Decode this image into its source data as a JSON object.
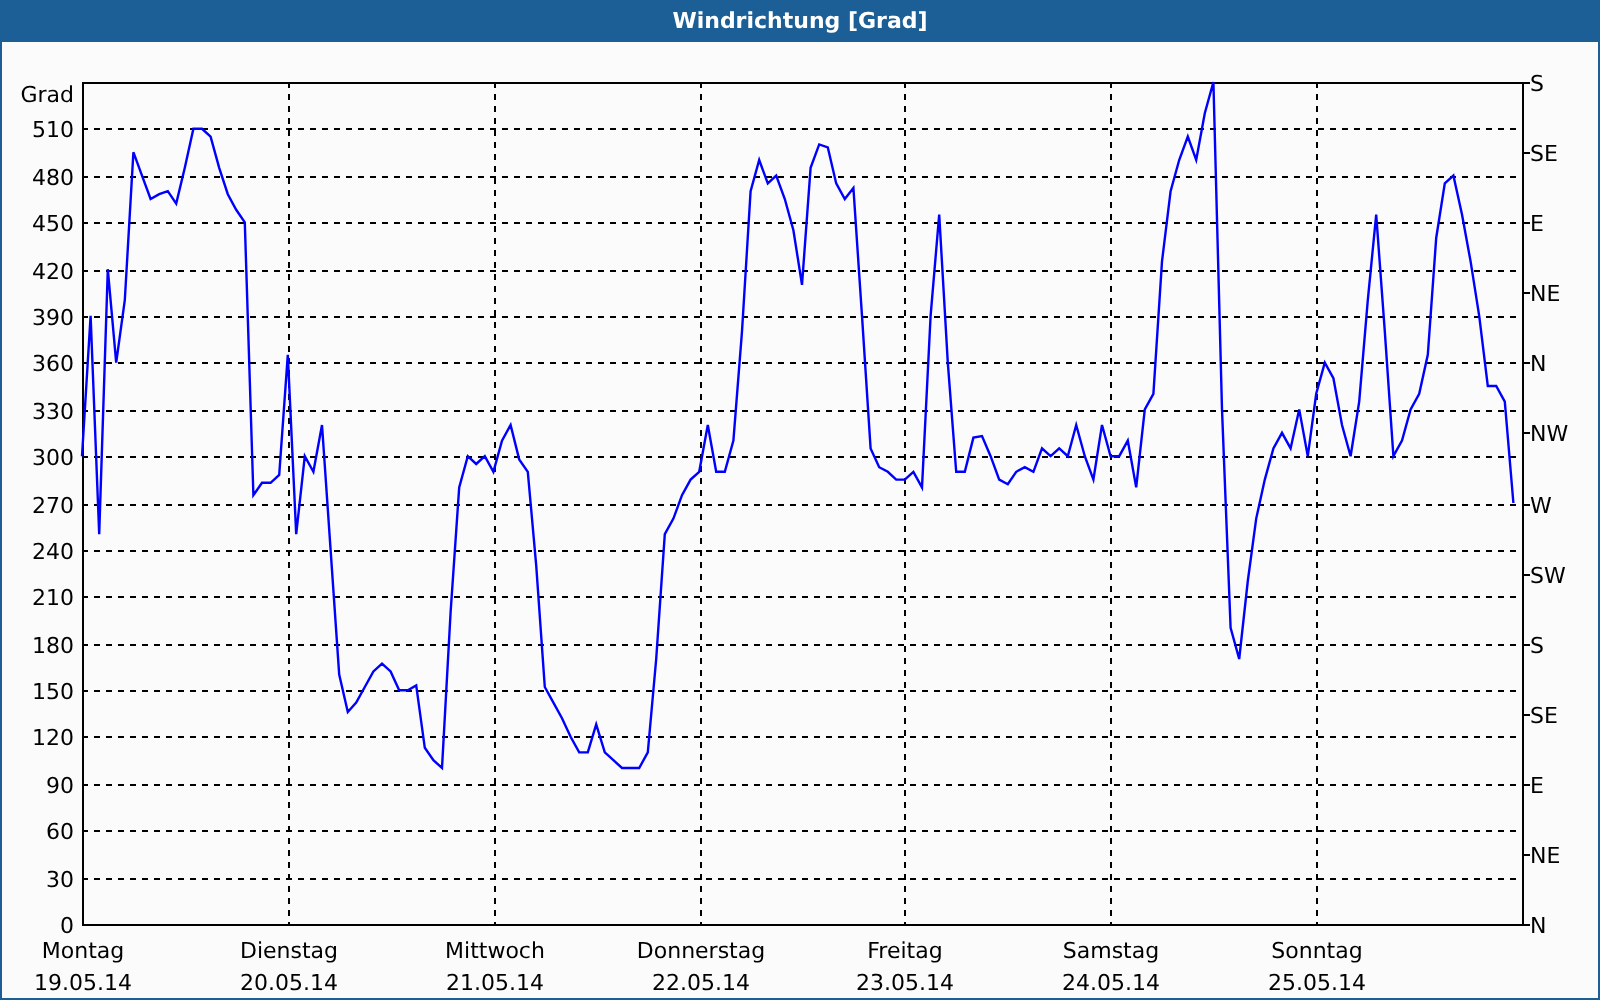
{
  "window": {
    "title": "Windrichtung [Grad]"
  },
  "chart": {
    "chart_data": {
      "type": "line",
      "grid": true,
      "ylabel": "Grad",
      "ylim": [
        0,
        540
      ],
      "yticks": [
        0,
        30,
        60,
        90,
        120,
        150,
        180,
        210,
        240,
        270,
        300,
        330,
        360,
        390,
        420,
        450,
        480,
        510
      ],
      "categories": [
        "Montag",
        null,
        null,
        null,
        null,
        null,
        null,
        null,
        null,
        null,
        null,
        null,
        null,
        null,
        null,
        null,
        null,
        null,
        null,
        null,
        null,
        null,
        null,
        null,
        "Dienstag",
        null,
        null,
        null,
        null,
        null,
        null,
        null,
        null,
        null,
        null,
        null,
        null,
        null,
        null,
        null,
        null,
        null,
        null,
        null,
        null,
        null,
        null,
        null,
        "Mittwoch",
        null,
        null,
        null,
        null,
        null,
        null,
        null,
        null,
        null,
        null,
        null,
        null,
        null,
        null,
        null,
        null,
        null,
        null,
        null,
        null,
        null,
        null,
        null,
        "Donnerstag",
        null,
        null,
        null,
        null,
        null,
        null,
        null,
        null,
        null,
        null,
        null,
        null,
        null,
        null,
        null,
        null,
        null,
        null,
        null,
        null,
        null,
        null,
        null,
        "Freitag",
        null,
        null,
        null,
        null,
        null,
        null,
        null,
        null,
        null,
        null,
        null,
        null,
        null,
        null,
        null,
        null,
        null,
        null,
        null,
        null,
        null,
        null,
        null,
        "Samstag",
        null,
        null,
        null,
        null,
        null,
        null,
        null,
        null,
        null,
        null,
        null,
        null,
        null,
        null,
        null,
        null,
        null,
        null,
        null,
        null,
        null,
        null,
        null,
        "Sonntag",
        null,
        null,
        null,
        null,
        null,
        null,
        null,
        null,
        null,
        null,
        null,
        null,
        null,
        null,
        null,
        null,
        null,
        null,
        null,
        null,
        null,
        null,
        null
      ],
      "series": [
        {
          "color": "#0000ff",
          "values": [
            300,
            390,
            250,
            420,
            360,
            400,
            495,
            480,
            465,
            468,
            470,
            462,
            485,
            510,
            510,
            505,
            485,
            468,
            458,
            450,
            275,
            283,
            283,
            288,
            365,
            250,
            300,
            290,
            320,
            240,
            160,
            136,
            142,
            152,
            162,
            167,
            162,
            150,
            150,
            153,
            113,
            105,
            100,
            200,
            280,
            300,
            295,
            300,
            290,
            310,
            320,
            298,
            290,
            230,
            152,
            142,
            132,
            120,
            110,
            110,
            128,
            110,
            105,
            100,
            100,
            100,
            110,
            170,
            250,
            260,
            275,
            285,
            290,
            320,
            290,
            290,
            310,
            380,
            470,
            490,
            475,
            480,
            465,
            445,
            410,
            485,
            500,
            498,
            475,
            465,
            472,
            390,
            305,
            293,
            290,
            285,
            285,
            290,
            280,
            390,
            455,
            360,
            290,
            290,
            312,
            313,
            300,
            285,
            282,
            290,
            293,
            290,
            305,
            300,
            305,
            300,
            320,
            300,
            285,
            320,
            300,
            300,
            310,
            280,
            330,
            340,
            425,
            470,
            490,
            505,
            490,
            520,
            540,
            330,
            190,
            170,
            220,
            260,
            285,
            305,
            315,
            305,
            330,
            300,
            340,
            360,
            350,
            320,
            300,
            335,
            400,
            455,
            380,
            300,
            310,
            330,
            340,
            365,
            440,
            475,
            480,
            455,
            425,
            390,
            345,
            345,
            335,
            270
          ]
        }
      ]
    },
    "date_labels": [
      "19.05.14",
      "20.05.14",
      "21.05.14",
      "22.05.14",
      "23.05.14",
      "24.05.14",
      "25.05.14"
    ],
    "right_axis_labels": [
      "S",
      "SE",
      "E",
      "NE",
      "N",
      "NW",
      "W",
      "SW",
      "S",
      "SE",
      "E",
      "NE",
      "N"
    ]
  }
}
